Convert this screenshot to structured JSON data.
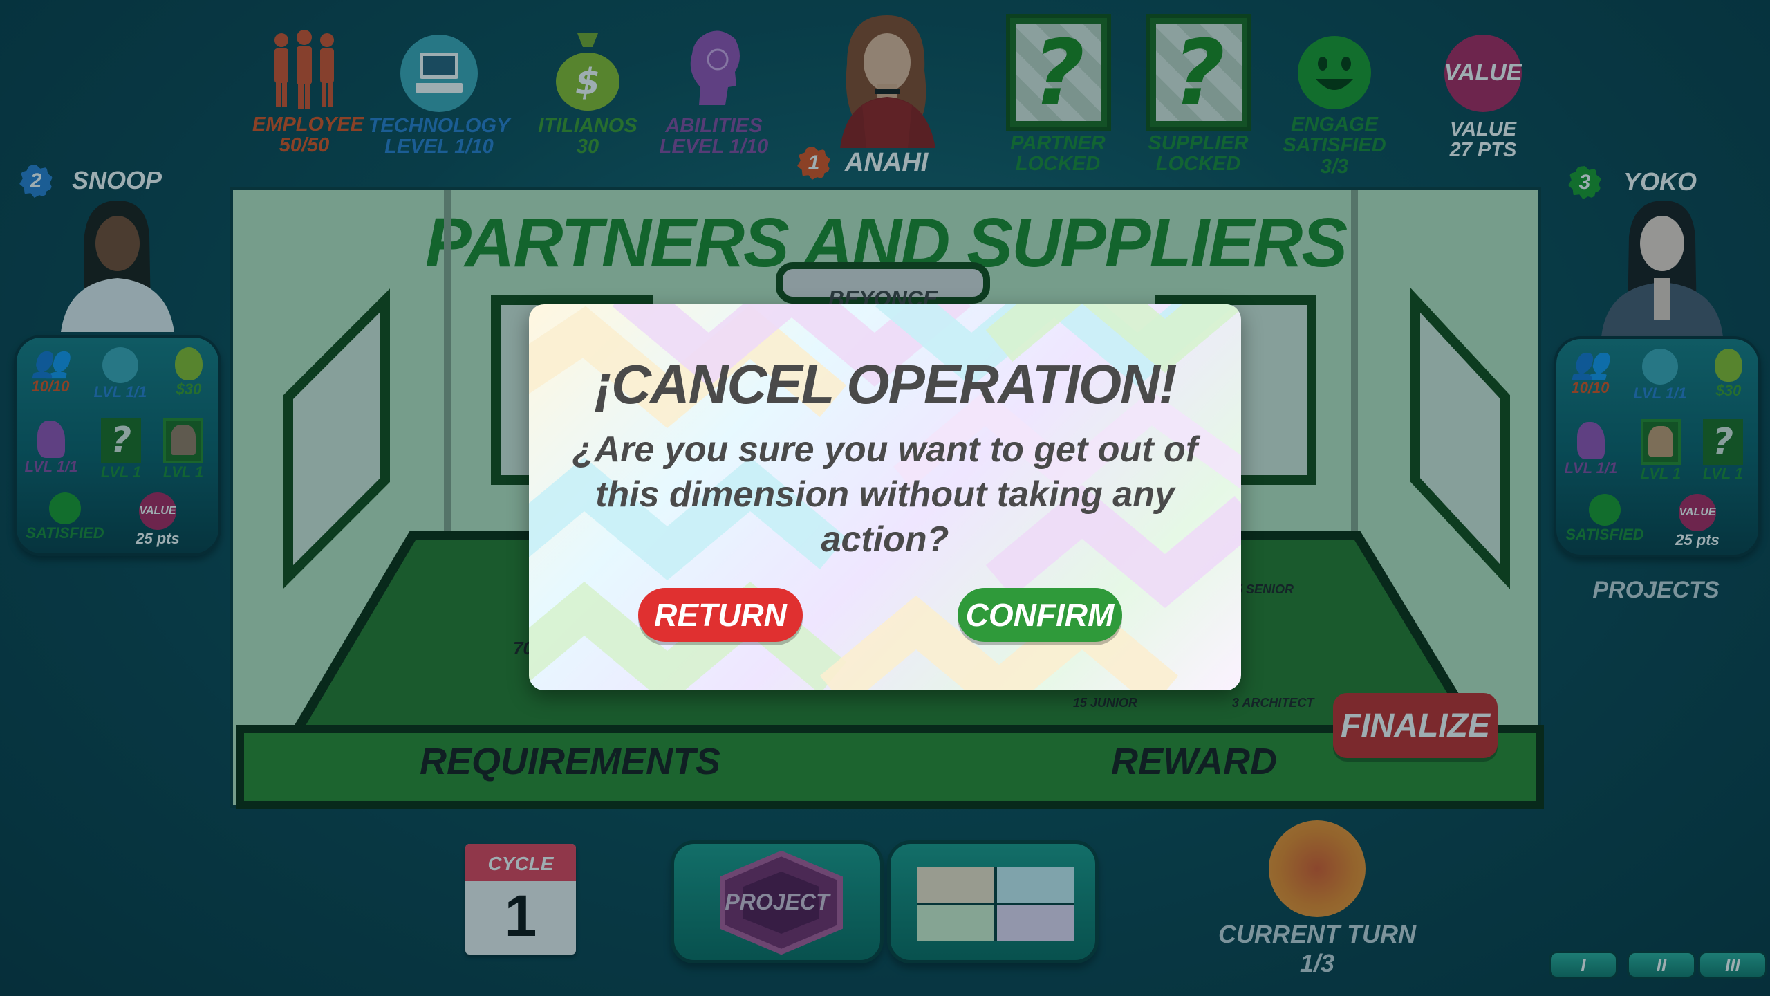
{
  "top_stats": {
    "employee": {
      "label": "EMPLOYEE",
      "value": "50/50",
      "color": "#e0521f"
    },
    "technology": {
      "label": "TECHNOLOGY",
      "value": "LEVEL  1/10",
      "color": "#2d7fd0"
    },
    "itilianos": {
      "label": "ITILIANOS",
      "value": "30",
      "color": "#3f9a2d"
    },
    "abilities": {
      "label": "ABILITIES",
      "value": "LEVEL  1/10",
      "color": "#8c4aa0"
    },
    "current_player": {
      "number": "1",
      "name": "ANAHI"
    },
    "partner": {
      "label": "PARTNER",
      "value": "LOCKED"
    },
    "supplier": {
      "label": "SUPPLIER",
      "value": "LOCKED"
    },
    "engage": {
      "label": "ENGAGE",
      "value": "SATISFIED",
      "extra": "3/3"
    },
    "value": {
      "badge": "VALUE",
      "label": "VALUE",
      "value": "27 PTS"
    }
  },
  "left_player": {
    "number": "2",
    "name": "SNOOP",
    "stats": {
      "employees": "10/10",
      "tech": "LVL 1/1",
      "money": "$30",
      "abilities": "LVL 1/1",
      "partner": "LVL 1",
      "supplier": "LVL 1",
      "engage": "SATISFIED",
      "value_badge": "VALUE",
      "value": "25 pts"
    }
  },
  "right_player": {
    "number": "3",
    "name": "YOKO",
    "stats": {
      "employees": "10/10",
      "tech": "LVL 1/1",
      "money": "$30",
      "abilities": "LVL 1/1",
      "partner": "LVL 1",
      "supplier": "LVL 1",
      "engage": "SATISFIED",
      "value_badge": "VALUE",
      "value": "25 pts"
    },
    "projects_label": "PROJECTS"
  },
  "board": {
    "title": "PARTNERS AND SUPPLIERS",
    "card_name": "BEYONCE",
    "left_number": "70",
    "roles": [
      "5 SENIOR",
      "15 JUNIOR",
      "3 ARCHITECT"
    ],
    "requirements_label": "REQUIREMENTS",
    "reward_label": "REWARD",
    "finalize_label": "FINALIZE"
  },
  "modal": {
    "title": "¡CANCEL OPERATION!",
    "message": "¿Are you sure you want to get out of this dimension without taking any action?",
    "return_label": "RETURN",
    "confirm_label": "CONFIRM"
  },
  "bottom": {
    "cycle_label": "CYCLE",
    "cycle_value": "1",
    "project_label": "PROJECT",
    "current_turn_label": "CURRENT TURN",
    "current_turn_value": "1/3",
    "pager": [
      "I",
      "II",
      "III"
    ]
  }
}
